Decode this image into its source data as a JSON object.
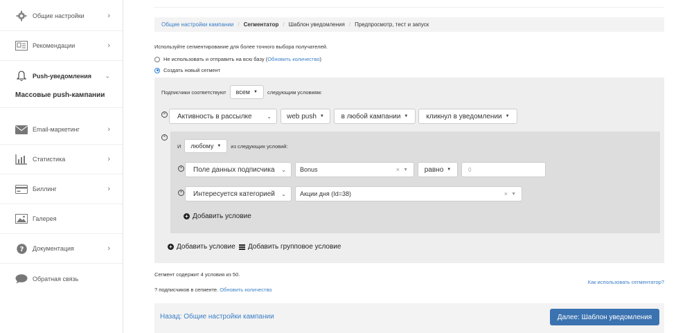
{
  "sidebar": {
    "items": [
      {
        "label": "Общие настройки",
        "icon": "gear-icon",
        "has_chevron": true
      },
      {
        "label": "Рекомендации",
        "icon": "recommendations-icon",
        "has_chevron": true
      },
      {
        "label": "Push-уведомления",
        "icon": "bell-icon",
        "has_chevron": true,
        "expanded": true
      },
      {
        "label": "Email-маркетинг",
        "icon": "envelope-icon",
        "has_chevron": true
      },
      {
        "label": "Статистика",
        "icon": "bar-chart-icon",
        "has_chevron": true
      },
      {
        "label": "Биллинг",
        "icon": "credit-card-icon",
        "has_chevron": true
      },
      {
        "label": "Галерея",
        "icon": "image-icon",
        "has_chevron": false
      },
      {
        "label": "Документация",
        "icon": "question-icon",
        "has_chevron": true
      },
      {
        "label": "Обратная связь",
        "icon": "chat-icon",
        "has_chevron": false
      }
    ],
    "active_subitem": "Массовые push-кампании"
  },
  "breadcrumb": {
    "step1": "Общие настройки кампании",
    "step2": "Сегментатор",
    "step3": "Шаблон уведомления",
    "step4": "Предпросмотр, тест и запуск",
    "sep": "/"
  },
  "segment": {
    "description": "Используйте сегментирование для более точного выбора получателей.",
    "option_all_prefix": "Не использовать и отправить на всю базу (",
    "option_all_link": "Обновить количество",
    "option_all_suffix": ")",
    "option_new": "Создать новый сегмент",
    "match_prefix": "Подписчики соответствуют",
    "match_value": "всем",
    "match_suffix": "следующим условиям:",
    "cond1": {
      "field": "Активность в рассылке",
      "channel": "web push",
      "scope": "в любой кампании",
      "action": "кликнул в уведомлении"
    },
    "group": {
      "prefix": "И",
      "match_value": "любому",
      "suffix": "из следующих условий:",
      "cond1": {
        "field": "Поле данных подписчика",
        "value": "Bonus",
        "operator": "равно",
        "input_placeholder": "0"
      },
      "cond2": {
        "field": "Интересуется категорией",
        "value": "Акции дня (Id=38)"
      },
      "add_condition": "Добавить условие"
    },
    "add_condition": "Добавить условие",
    "add_group_condition": "Добавить групповое условие",
    "contains_info": "Сегмент содержит 4 условия из 50.",
    "subscribers_prefix": "? подписчиков в сегменте.",
    "subscribers_link": "Обновить количество",
    "help_link": "Как использовать сегментатор?"
  },
  "footer": {
    "back": "Назад: Общие настройки кампании",
    "next": "Далее: Шаблон уведомления"
  },
  "colors": {
    "accent": "#3a7ec6",
    "primary_button": "#3b72b0"
  }
}
